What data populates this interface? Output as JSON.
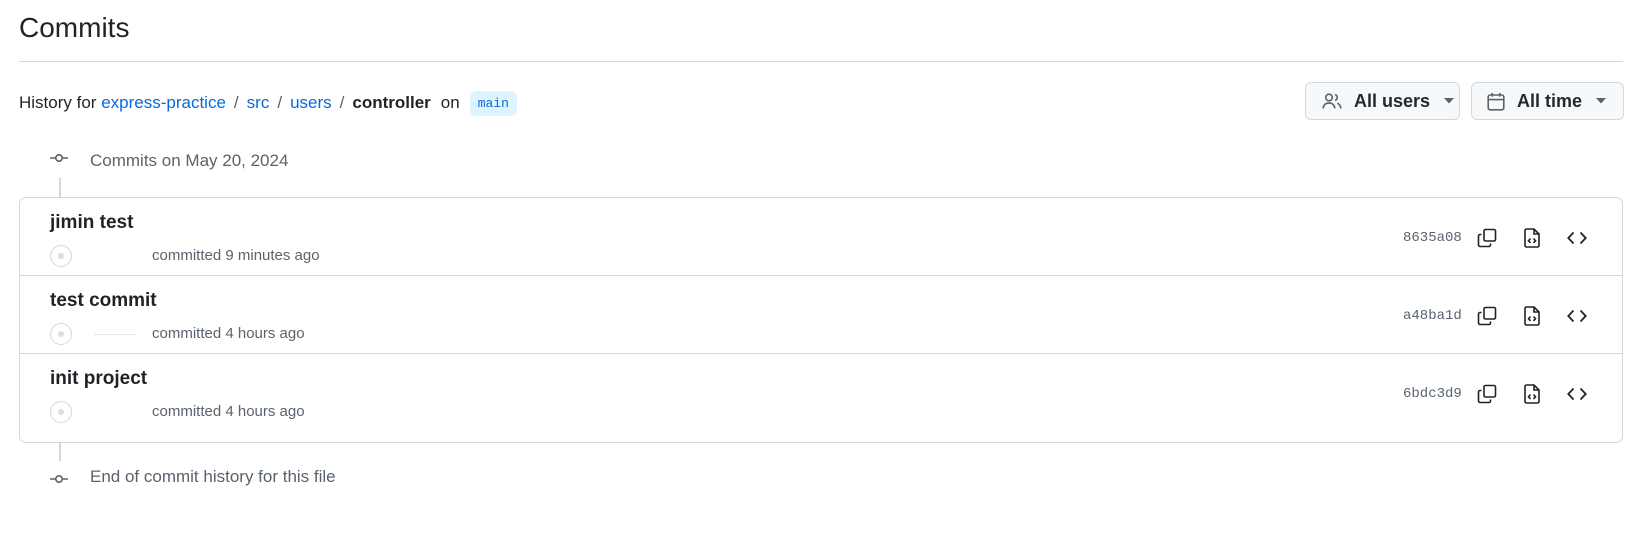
{
  "page": {
    "title": "Commits"
  },
  "history": {
    "prefix": "History for",
    "repo": "express-practice",
    "path_parts": [
      "src",
      "users"
    ],
    "separator": "/",
    "file": "controller",
    "on_word": "on",
    "branch": "main"
  },
  "filters": {
    "users_label": "All users",
    "time_label": "All time"
  },
  "group": {
    "label": "Commits on May 20, 2024"
  },
  "commits": [
    {
      "message": "jimin test",
      "committed_text": "committed 9 minutes ago",
      "sha": "8635a08"
    },
    {
      "message": "test commit",
      "committed_text": "committed 4 hours ago",
      "sha": "a48ba1d"
    },
    {
      "message": "init project",
      "committed_text": "committed 4 hours ago",
      "sha": "6bdc3d9"
    }
  ],
  "end_label": "End of commit history for this file",
  "icons": {
    "users": "people-icon",
    "time": "calendar-icon",
    "copy": "copy-icon",
    "file": "file-code-icon",
    "code": "code-icon",
    "commit": "git-commit-icon"
  },
  "colors": {
    "link": "#0969da",
    "muted": "#59636e",
    "border": "#d1d9e0",
    "branch_bg": "#ddf4ff"
  }
}
